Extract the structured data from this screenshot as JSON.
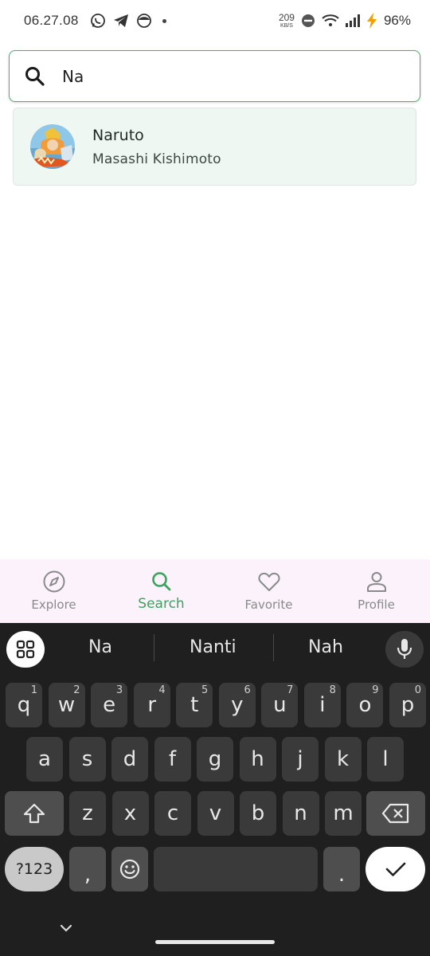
{
  "status_bar": {
    "time": "06.27.08",
    "net_speed_value": "209",
    "net_speed_unit": "KB/S",
    "battery": "96%"
  },
  "search": {
    "value": "Na",
    "placeholder": ""
  },
  "results": [
    {
      "title": "Naruto",
      "author": "Masashi Kishimoto"
    }
  ],
  "bottom_nav": {
    "active": "search",
    "items": [
      {
        "id": "explore",
        "label": "Explore",
        "icon": "compass-icon"
      },
      {
        "id": "search",
        "label": "Search",
        "icon": "search-icon"
      },
      {
        "id": "favorite",
        "label": "Favorite",
        "icon": "heart-icon"
      },
      {
        "id": "profile",
        "label": "Profile",
        "icon": "person-icon"
      }
    ]
  },
  "keyboard": {
    "suggestions": [
      "Na",
      "Nanti",
      "Nah"
    ],
    "row1": [
      {
        "key": "q",
        "hint": "1"
      },
      {
        "key": "w",
        "hint": "2"
      },
      {
        "key": "e",
        "hint": "3"
      },
      {
        "key": "r",
        "hint": "4"
      },
      {
        "key": "t",
        "hint": "5"
      },
      {
        "key": "y",
        "hint": "6"
      },
      {
        "key": "u",
        "hint": "7"
      },
      {
        "key": "i",
        "hint": "8"
      },
      {
        "key": "o",
        "hint": "9"
      },
      {
        "key": "p",
        "hint": "0"
      }
    ],
    "row2": [
      "a",
      "s",
      "d",
      "f",
      "g",
      "h",
      "j",
      "k",
      "l"
    ],
    "row3": [
      "z",
      "x",
      "c",
      "v",
      "b",
      "n",
      "m"
    ],
    "symbols_label": "?123",
    "comma": ",",
    "period": "."
  },
  "colors": {
    "accent": "#3aa35c",
    "search_border": "#4caf6a",
    "card_bg": "#eef7f1",
    "nav_bg": "#fbf2fb",
    "keyboard_bg": "#1f1f1f"
  }
}
